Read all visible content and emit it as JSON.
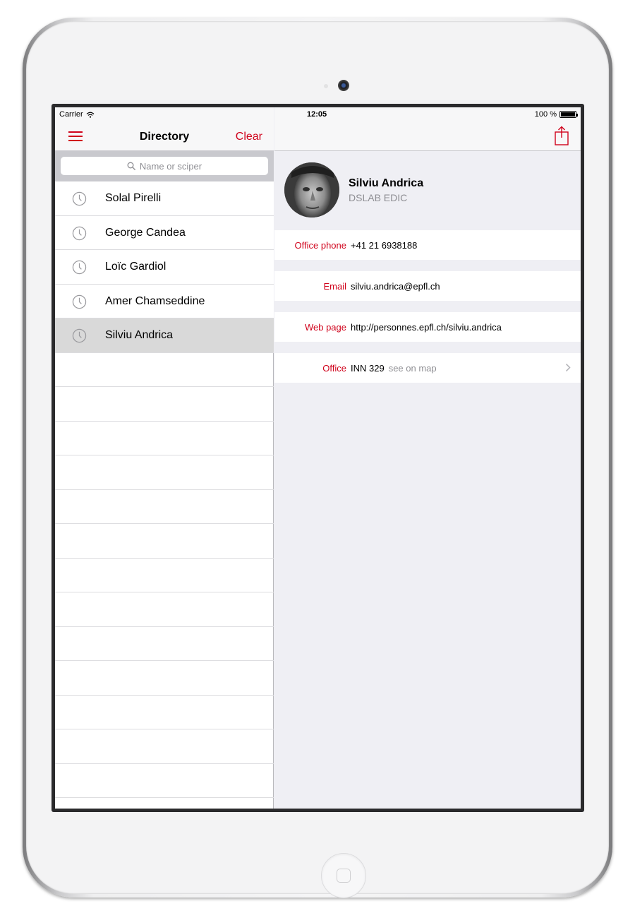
{
  "status_bar": {
    "carrier": "Carrier",
    "time": "12:05",
    "battery": "100 %"
  },
  "directory": {
    "title": "Directory",
    "clear_label": "Clear",
    "search_placeholder": "Name or sciper",
    "recent_items": [
      {
        "label": "Solal Pirelli",
        "icon": "clock-icon"
      },
      {
        "label": "George Candea",
        "icon": "clock-icon"
      },
      {
        "label": "Loïc Gardiol",
        "icon": "clock-icon"
      },
      {
        "label": "Amer Chamseddine",
        "icon": "clock-icon"
      },
      {
        "label": "Silviu Andrica",
        "icon": "clock-icon",
        "selected": true
      }
    ]
  },
  "person": {
    "name": "Silviu Andrica",
    "unit": "DSLAB EDIC",
    "office_phone_label": "Office phone",
    "office_phone": "+41 21 6938188",
    "email_label": "Email",
    "email": "silviu.andrica@epfl.ch",
    "web_label": "Web page",
    "web": "http://personnes.epfl.ch/silviu.andrica",
    "office_label": "Office",
    "office": "INN 329",
    "map_link": "see on map"
  },
  "colors": {
    "accent": "#d0021b",
    "background": "#efeff4",
    "selected_row": "#d9d9d9"
  }
}
